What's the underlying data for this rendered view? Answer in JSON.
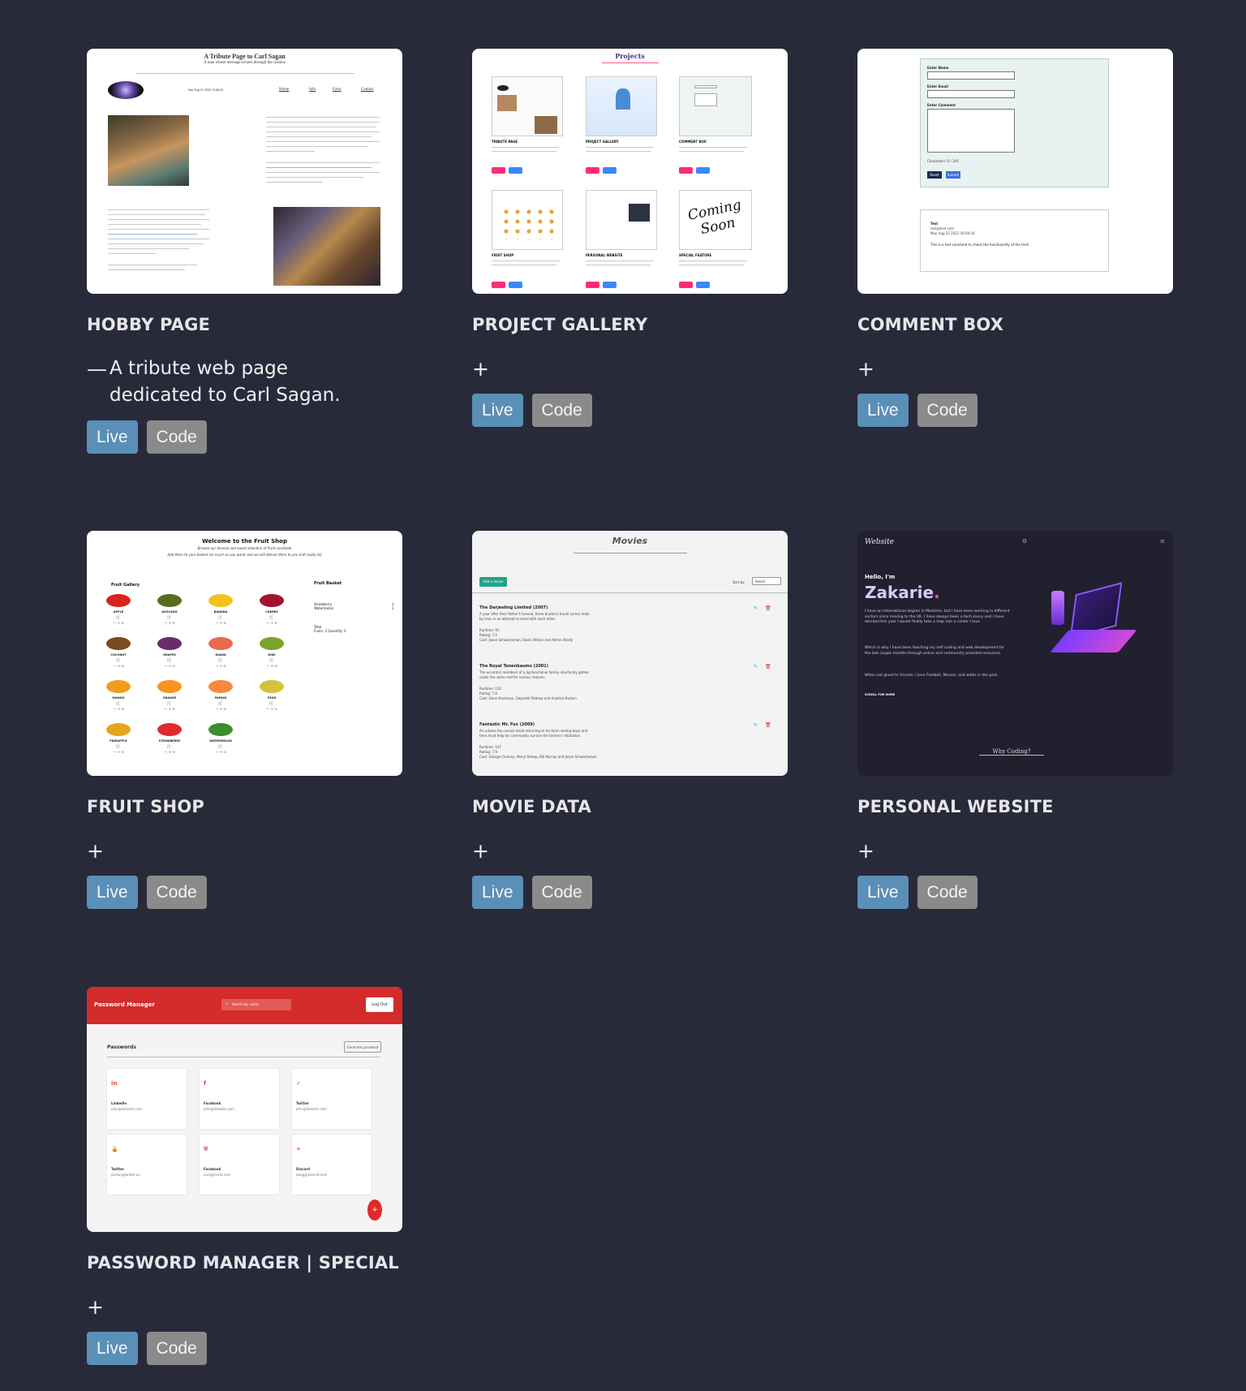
{
  "projects": [
    {
      "title": "HOBBY PAGE",
      "toggle": "—",
      "description": "A tribute web page dedicated to Carl Sagan.",
      "live": "Live",
      "code": "Code",
      "thumb": {
        "heading": "A Tribute Page to Carl Sagan",
        "sub": "A man whose message echoes through the cosmos",
        "date": "Sun Aug 21 2022 13:46:42",
        "nav": [
          "Home",
          "Info",
          "Facts",
          "Contact"
        ]
      }
    },
    {
      "title": "PROJECT GALLERY",
      "toggle": "+",
      "live": "Live",
      "code": "Code",
      "thumb": {
        "heading": "Projects",
        "items": [
          "TRIBUTE PAGE",
          "PROJECT GALLERY",
          "COMMENT BOX",
          "FRUIT SHOP",
          "PERSONAL WEBSITE",
          "SPECIAL FEATURE"
        ],
        "coming": "Coming Soon"
      }
    },
    {
      "title": "COMMENT BOX",
      "toggle": "+",
      "live": "Live",
      "code": "Code",
      "thumb": {
        "labels": [
          "Enter Name",
          "Enter Email",
          "Enter Comment"
        ],
        "chars": "Characters: 0 / 140",
        "buttons": [
          "Reset",
          "Submit"
        ],
        "comment_name": "Test",
        "comment_email": "test@test.com",
        "comment_date": "Mon Aug 22 2022 16:00:34",
        "comment_text": "This is a test comment to check the functionality of the form"
      }
    },
    {
      "title": "FRUIT SHOP",
      "toggle": "+",
      "live": "Live",
      "code": "Code",
      "thumb": {
        "heading": "Welcome to the Fruit Shop",
        "sub1": "Browse our diverse and sweet selection of fruits available",
        "sub2": "Add them to your basket (as much as you want) and we will deliver them to you (not really lol)",
        "gallery": "Fruit Gallery",
        "basket": "Fruit Basket",
        "basket_items": [
          "Strawberry",
          "Watermelon"
        ],
        "basket_counts": [
          "1",
          "1"
        ],
        "total": "Total",
        "total_line": "Fruits: 2  Quantity: 2",
        "fruits": [
          "APPLE",
          "AVOCADO",
          "BANANA",
          "CHERRY",
          "COCONUT",
          "GRAPES",
          "GUAVA",
          "KIWI",
          "MANGO",
          "ORANGE",
          "PAPAYA",
          "PEAR",
          "PINEAPPLE",
          "STRAWBERRY",
          "WATERMELON"
        ]
      }
    },
    {
      "title": "MOVIE DATA",
      "toggle": "+",
      "live": "Live",
      "code": "Code",
      "thumb": {
        "heading": "Movies",
        "add": "Add a movie",
        "sort": "Sort by:",
        "select": "Select",
        "movies": [
          {
            "name": "The Darjeeling Limited (2007)",
            "desc1": "A year after their father's funeral, three brothers travel across India",
            "desc2": "by train in an attempt to bond with each other.",
            "runtime": "Runtime: 91",
            "rating": "Rating: 7.2",
            "cast": "Cast: Jason Schwartzman, Owen Wilson and Adrien Brody"
          },
          {
            "name": "The Royal Tenenbaums (2001)",
            "desc1": "The eccentric members of a dysfunctional family reluctantly gather",
            "desc2": "under the same roof for various reasons",
            "runtime": "Runtime: 110",
            "rating": "Rating: 7.6",
            "cast": "Cast: Gene Hackman, Gwyneth Paltrow and Anjelica Huston"
          },
          {
            "name": "Fantastic Mr. Fox (2009)",
            "desc1": "An urbane fox cannot resist returning to his farm raiding ways and",
            "desc2": "then must help his community survive the farmers' retaliation.",
            "runtime": "Runtime: 147",
            "rating": "Rating: 7.9",
            "cast": "Cast: George Clooney, Meryl Streep, Bill Murray and Jason Schwartzman"
          }
        ]
      }
    },
    {
      "title": "PERSONAL WEBSITE",
      "toggle": "+",
      "live": "Live",
      "code": "Code",
      "thumb": {
        "brand": "Website",
        "hello": "Hello, I'm",
        "name": "Zakarie",
        "dot": ".",
        "p1": "I have an international degree in Medicine, but I have been working in different sectors since moving to the UK. I have always been a tech savvy and I have decided this year I would finally take a leap into a career I love.",
        "p2": "Which is why I have been teaching my self coding and web development for the last couple months through online and community provided resources.",
        "p3": "When not glued to Vscode, I love Football, Movies, and walks in the park.",
        "scroll": "SCROLL FOR MORE",
        "why": "Why Coding?"
      }
    },
    {
      "title": "PASSWORD MANAGER | SPECIAL",
      "toggle": "+",
      "live": "Live",
      "code": "Code",
      "thumb": {
        "brand": "Password Manager",
        "search": "Search by name",
        "logout": "Log Out",
        "section": "Passwords",
        "generate": "Generate password",
        "entries": [
          {
            "name": "LinkedIn",
            "email": "john@linkedin.com"
          },
          {
            "name": "Facebook",
            "email": "john@linkedin.com"
          },
          {
            "name": "Twitter",
            "email": "john@linkedin.com"
          },
          {
            "name": "Twitter",
            "email": "jordan@twitter.eu"
          },
          {
            "name": "Facebook",
            "email": "zuck@meta.com"
          },
          {
            "name": "Discord",
            "email": "dang@discord.com"
          }
        ],
        "fab": "+"
      }
    }
  ]
}
